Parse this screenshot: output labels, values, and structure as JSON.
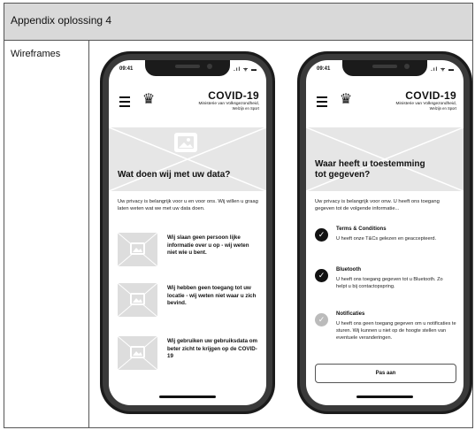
{
  "header": {
    "title": "Appendix oplossing 4"
  },
  "left_label": "Wireframes",
  "phone_common": {
    "time": "09:41",
    "status": ".ıl ᯤ ▬",
    "app_title": "COVID-19",
    "ministry": "Ministerie van Volksgezondheid,",
    "ministry_sub": "Welzijn en Sport",
    "menu_icon": "hamburger-icon",
    "crest_icon": "royal-crest-icon",
    "image_icon": "image-placeholder-icon"
  },
  "phone1": {
    "hero_title": "Wat doen wij met uw data?",
    "intro": "Uw privacy is belangrijk voor u en voor ons. Wij willen u graag laten weten wat we met uw data doen.",
    "features": [
      {
        "text": "Wij slaan geen persoon lijke informatie over u op - wij weten niet wie u bent."
      },
      {
        "text": "Wij hebben geen toegang tot uw locatie - wij weten niet waar u zich bevind."
      },
      {
        "text": "Wij gebruiken uw gebruiksdata om beter zicht te krijgen op de COVID-19"
      }
    ]
  },
  "phone2": {
    "hero_title": "Waar heeft u toestemming tot gegeven?",
    "intro": "Uw privacy is belangrijk voor onw. U heeft ons toegang gegeven tot de volgende informatie...",
    "permissions": [
      {
        "title": "Terms & Conditions",
        "desc": "U heeft onze T&Cs gelezen en geaccepteerd.",
        "checked": true
      },
      {
        "title": "Bluetooth",
        "desc": "U heeft ons toegang gegeven tot u Bluetooth. Zo helpt u bij contactopspring.",
        "checked": true
      },
      {
        "title": "Notificaties",
        "desc": "U heeft ons geen toegang gegeven om u notificaties te sturen. Wij kunnen u niet op de hoogte stellen van eventuele veranderingen.",
        "checked": false
      }
    ],
    "button_label": "Pas aan"
  },
  "colors": {
    "header_bg": "#d9d9d9",
    "phone_frame": "#1b1b1b",
    "check_on": "#111111",
    "check_off": "#bbbbbb"
  }
}
